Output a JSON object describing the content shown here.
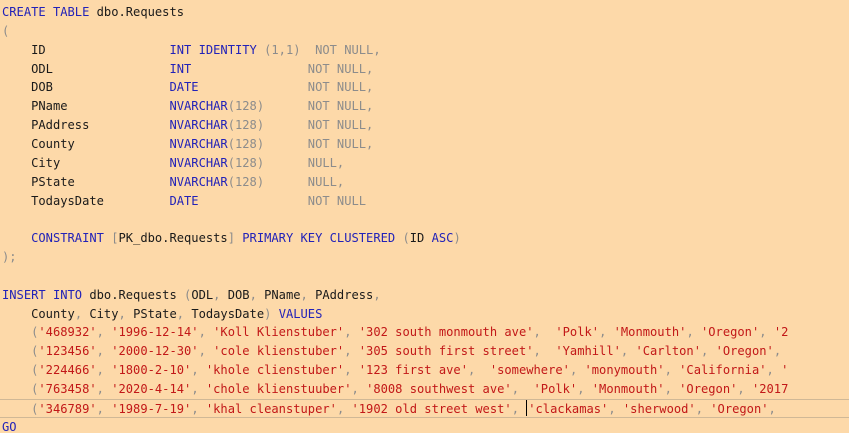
{
  "colors": {
    "background": "#fdd9a9",
    "keyword": "#2222b8",
    "punctuation": "#8c8c8c",
    "string": "#c21818",
    "identifier": "#1a1a1a"
  },
  "editor": {
    "lines": [
      [
        {
          "t": "kw",
          "v": "CREATE TABLE "
        },
        {
          "t": "id",
          "v": "dbo.Requests"
        }
      ],
      [
        {
          "t": "gr",
          "v": "("
        }
      ],
      [
        {
          "t": "id",
          "v": "    ID                 "
        },
        {
          "t": "ty",
          "v": "INT IDENTITY "
        },
        {
          "t": "gr",
          "v": "(1,1)  NOT NULL,"
        }
      ],
      [
        {
          "t": "id",
          "v": "    ODL                "
        },
        {
          "t": "ty",
          "v": "INT"
        },
        {
          "t": "gr",
          "v": "                NOT NULL,"
        }
      ],
      [
        {
          "t": "id",
          "v": "    DOB                "
        },
        {
          "t": "ty",
          "v": "DATE"
        },
        {
          "t": "gr",
          "v": "               NOT NULL,"
        }
      ],
      [
        {
          "t": "id",
          "v": "    PName              "
        },
        {
          "t": "ty",
          "v": "NVARCHAR"
        },
        {
          "t": "gr",
          "v": "(128)"
        },
        {
          "t": "gr",
          "v": "      NOT NULL,"
        }
      ],
      [
        {
          "t": "id",
          "v": "    PAddress           "
        },
        {
          "t": "ty",
          "v": "NVARCHAR"
        },
        {
          "t": "gr",
          "v": "(128)"
        },
        {
          "t": "gr",
          "v": "      NOT NULL,"
        }
      ],
      [
        {
          "t": "id",
          "v": "    County             "
        },
        {
          "t": "ty",
          "v": "NVARCHAR"
        },
        {
          "t": "gr",
          "v": "(128)"
        },
        {
          "t": "gr",
          "v": "      NOT NULL,"
        }
      ],
      [
        {
          "t": "id",
          "v": "    City               "
        },
        {
          "t": "ty",
          "v": "NVARCHAR"
        },
        {
          "t": "gr",
          "v": "(128)"
        },
        {
          "t": "gr",
          "v": "      NULL,"
        }
      ],
      [
        {
          "t": "id",
          "v": "    PState             "
        },
        {
          "t": "ty",
          "v": "NVARCHAR"
        },
        {
          "t": "gr",
          "v": "(128)"
        },
        {
          "t": "gr",
          "v": "      NULL,"
        }
      ],
      [
        {
          "t": "id",
          "v": "    TodaysDate         "
        },
        {
          "t": "ty",
          "v": "DATE"
        },
        {
          "t": "gr",
          "v": "               NOT NULL"
        }
      ],
      [],
      [
        {
          "t": "id",
          "v": "    "
        },
        {
          "t": "kw",
          "v": "CONSTRAINT "
        },
        {
          "t": "gr",
          "v": "["
        },
        {
          "t": "id",
          "v": "PK_dbo.Requests"
        },
        {
          "t": "gr",
          "v": "] "
        },
        {
          "t": "kw",
          "v": "PRIMARY KEY CLUSTERED "
        },
        {
          "t": "gr",
          "v": "("
        },
        {
          "t": "id",
          "v": "ID "
        },
        {
          "t": "kw",
          "v": "ASC"
        },
        {
          "t": "gr",
          "v": ")"
        }
      ],
      [
        {
          "t": "gr",
          "v": ");"
        }
      ],
      [],
      [
        {
          "t": "kw",
          "v": "INSERT INTO "
        },
        {
          "t": "id",
          "v": "dbo.Requests "
        },
        {
          "t": "gr",
          "v": "("
        },
        {
          "t": "id",
          "v": "ODL"
        },
        {
          "t": "gr",
          "v": ", "
        },
        {
          "t": "id",
          "v": "DOB"
        },
        {
          "t": "gr",
          "v": ", "
        },
        {
          "t": "id",
          "v": "PName"
        },
        {
          "t": "gr",
          "v": ", "
        },
        {
          "t": "id",
          "v": "PAddress"
        },
        {
          "t": "gr",
          "v": ","
        }
      ],
      [
        {
          "t": "id",
          "v": "    County"
        },
        {
          "t": "gr",
          "v": ", "
        },
        {
          "t": "id",
          "v": "City"
        },
        {
          "t": "gr",
          "v": ", "
        },
        {
          "t": "id",
          "v": "PState"
        },
        {
          "t": "gr",
          "v": ", "
        },
        {
          "t": "id",
          "v": "TodaysDate"
        },
        {
          "t": "gr",
          "v": ") "
        },
        {
          "t": "kw",
          "v": "VALUES"
        }
      ],
      [
        {
          "t": "gr",
          "v": "    ("
        },
        {
          "t": "st",
          "v": "'468932'"
        },
        {
          "t": "gr",
          "v": ", "
        },
        {
          "t": "st",
          "v": "'1996-12-14'"
        },
        {
          "t": "gr",
          "v": ", "
        },
        {
          "t": "st",
          "v": "'Koll Klienstuber'"
        },
        {
          "t": "gr",
          "v": ", "
        },
        {
          "t": "st",
          "v": "'302 south monmouth ave'"
        },
        {
          "t": "gr",
          "v": ",  "
        },
        {
          "t": "st",
          "v": "'Polk'"
        },
        {
          "t": "gr",
          "v": ", "
        },
        {
          "t": "st",
          "v": "'Monmouth'"
        },
        {
          "t": "gr",
          "v": ", "
        },
        {
          "t": "st",
          "v": "'Oregon'"
        },
        {
          "t": "gr",
          "v": ", "
        },
        {
          "t": "st",
          "v": "'2"
        }
      ],
      [
        {
          "t": "gr",
          "v": "    ("
        },
        {
          "t": "st",
          "v": "'123456'"
        },
        {
          "t": "gr",
          "v": ", "
        },
        {
          "t": "st",
          "v": "'2000-12-30'"
        },
        {
          "t": "gr",
          "v": ", "
        },
        {
          "t": "st",
          "v": "'cole klienstuber'"
        },
        {
          "t": "gr",
          "v": ", "
        },
        {
          "t": "st",
          "v": "'305 south first street'"
        },
        {
          "t": "gr",
          "v": ",  "
        },
        {
          "t": "st",
          "v": "'Yamhill'"
        },
        {
          "t": "gr",
          "v": ", "
        },
        {
          "t": "st",
          "v": "'Carlton'"
        },
        {
          "t": "gr",
          "v": ", "
        },
        {
          "t": "st",
          "v": "'Oregon'"
        },
        {
          "t": "gr",
          "v": ", "
        }
      ],
      [
        {
          "t": "gr",
          "v": "    ("
        },
        {
          "t": "st",
          "v": "'224466'"
        },
        {
          "t": "gr",
          "v": ", "
        },
        {
          "t": "st",
          "v": "'1800-2-10'"
        },
        {
          "t": "gr",
          "v": ", "
        },
        {
          "t": "st",
          "v": "'khole clienstuber'"
        },
        {
          "t": "gr",
          "v": ", "
        },
        {
          "t": "st",
          "v": "'123 first ave'"
        },
        {
          "t": "gr",
          "v": ",  "
        },
        {
          "t": "st",
          "v": "'somewhere'"
        },
        {
          "t": "gr",
          "v": ", "
        },
        {
          "t": "st",
          "v": "'monymouth'"
        },
        {
          "t": "gr",
          "v": ", "
        },
        {
          "t": "st",
          "v": "'California'"
        },
        {
          "t": "gr",
          "v": ", "
        },
        {
          "t": "st",
          "v": "'"
        }
      ],
      [
        {
          "t": "gr",
          "v": "    ("
        },
        {
          "t": "st",
          "v": "'763458'"
        },
        {
          "t": "gr",
          "v": ", "
        },
        {
          "t": "st",
          "v": "'2020-4-14'"
        },
        {
          "t": "gr",
          "v": ", "
        },
        {
          "t": "st",
          "v": "'chole klienstuuber'"
        },
        {
          "t": "gr",
          "v": ", "
        },
        {
          "t": "st",
          "v": "'8008 southwest ave'"
        },
        {
          "t": "gr",
          "v": ",  "
        },
        {
          "t": "st",
          "v": "'Polk'"
        },
        {
          "t": "gr",
          "v": ", "
        },
        {
          "t": "st",
          "v": "'Monmouth'"
        },
        {
          "t": "gr",
          "v": ", "
        },
        {
          "t": "st",
          "v": "'Oregon'"
        },
        {
          "t": "gr",
          "v": ", "
        },
        {
          "t": "st",
          "v": "'2017"
        }
      ],
      [
        {
          "t": "gr",
          "v": "    ("
        },
        {
          "t": "st",
          "v": "'346789'"
        },
        {
          "t": "gr",
          "v": ", "
        },
        {
          "t": "st",
          "v": "'1989-7-19'"
        },
        {
          "t": "gr",
          "v": ", "
        },
        {
          "t": "st",
          "v": "'khal cleanstuper'"
        },
        {
          "t": "gr",
          "v": ", "
        },
        {
          "t": "st",
          "v": "'1902 old street west'"
        },
        {
          "t": "gr",
          "v": ", "
        },
        {
          "t": "caret",
          "v": ""
        },
        {
          "t": "st",
          "v": "'clackamas'"
        },
        {
          "t": "gr",
          "v": ", "
        },
        {
          "t": "st",
          "v": "'sherwood'"
        },
        {
          "t": "gr",
          "v": ", "
        },
        {
          "t": "st",
          "v": "'Oregon'"
        },
        {
          "t": "gr",
          "v": ", "
        }
      ],
      [
        {
          "t": "kw",
          "v": "GO"
        }
      ]
    ]
  }
}
